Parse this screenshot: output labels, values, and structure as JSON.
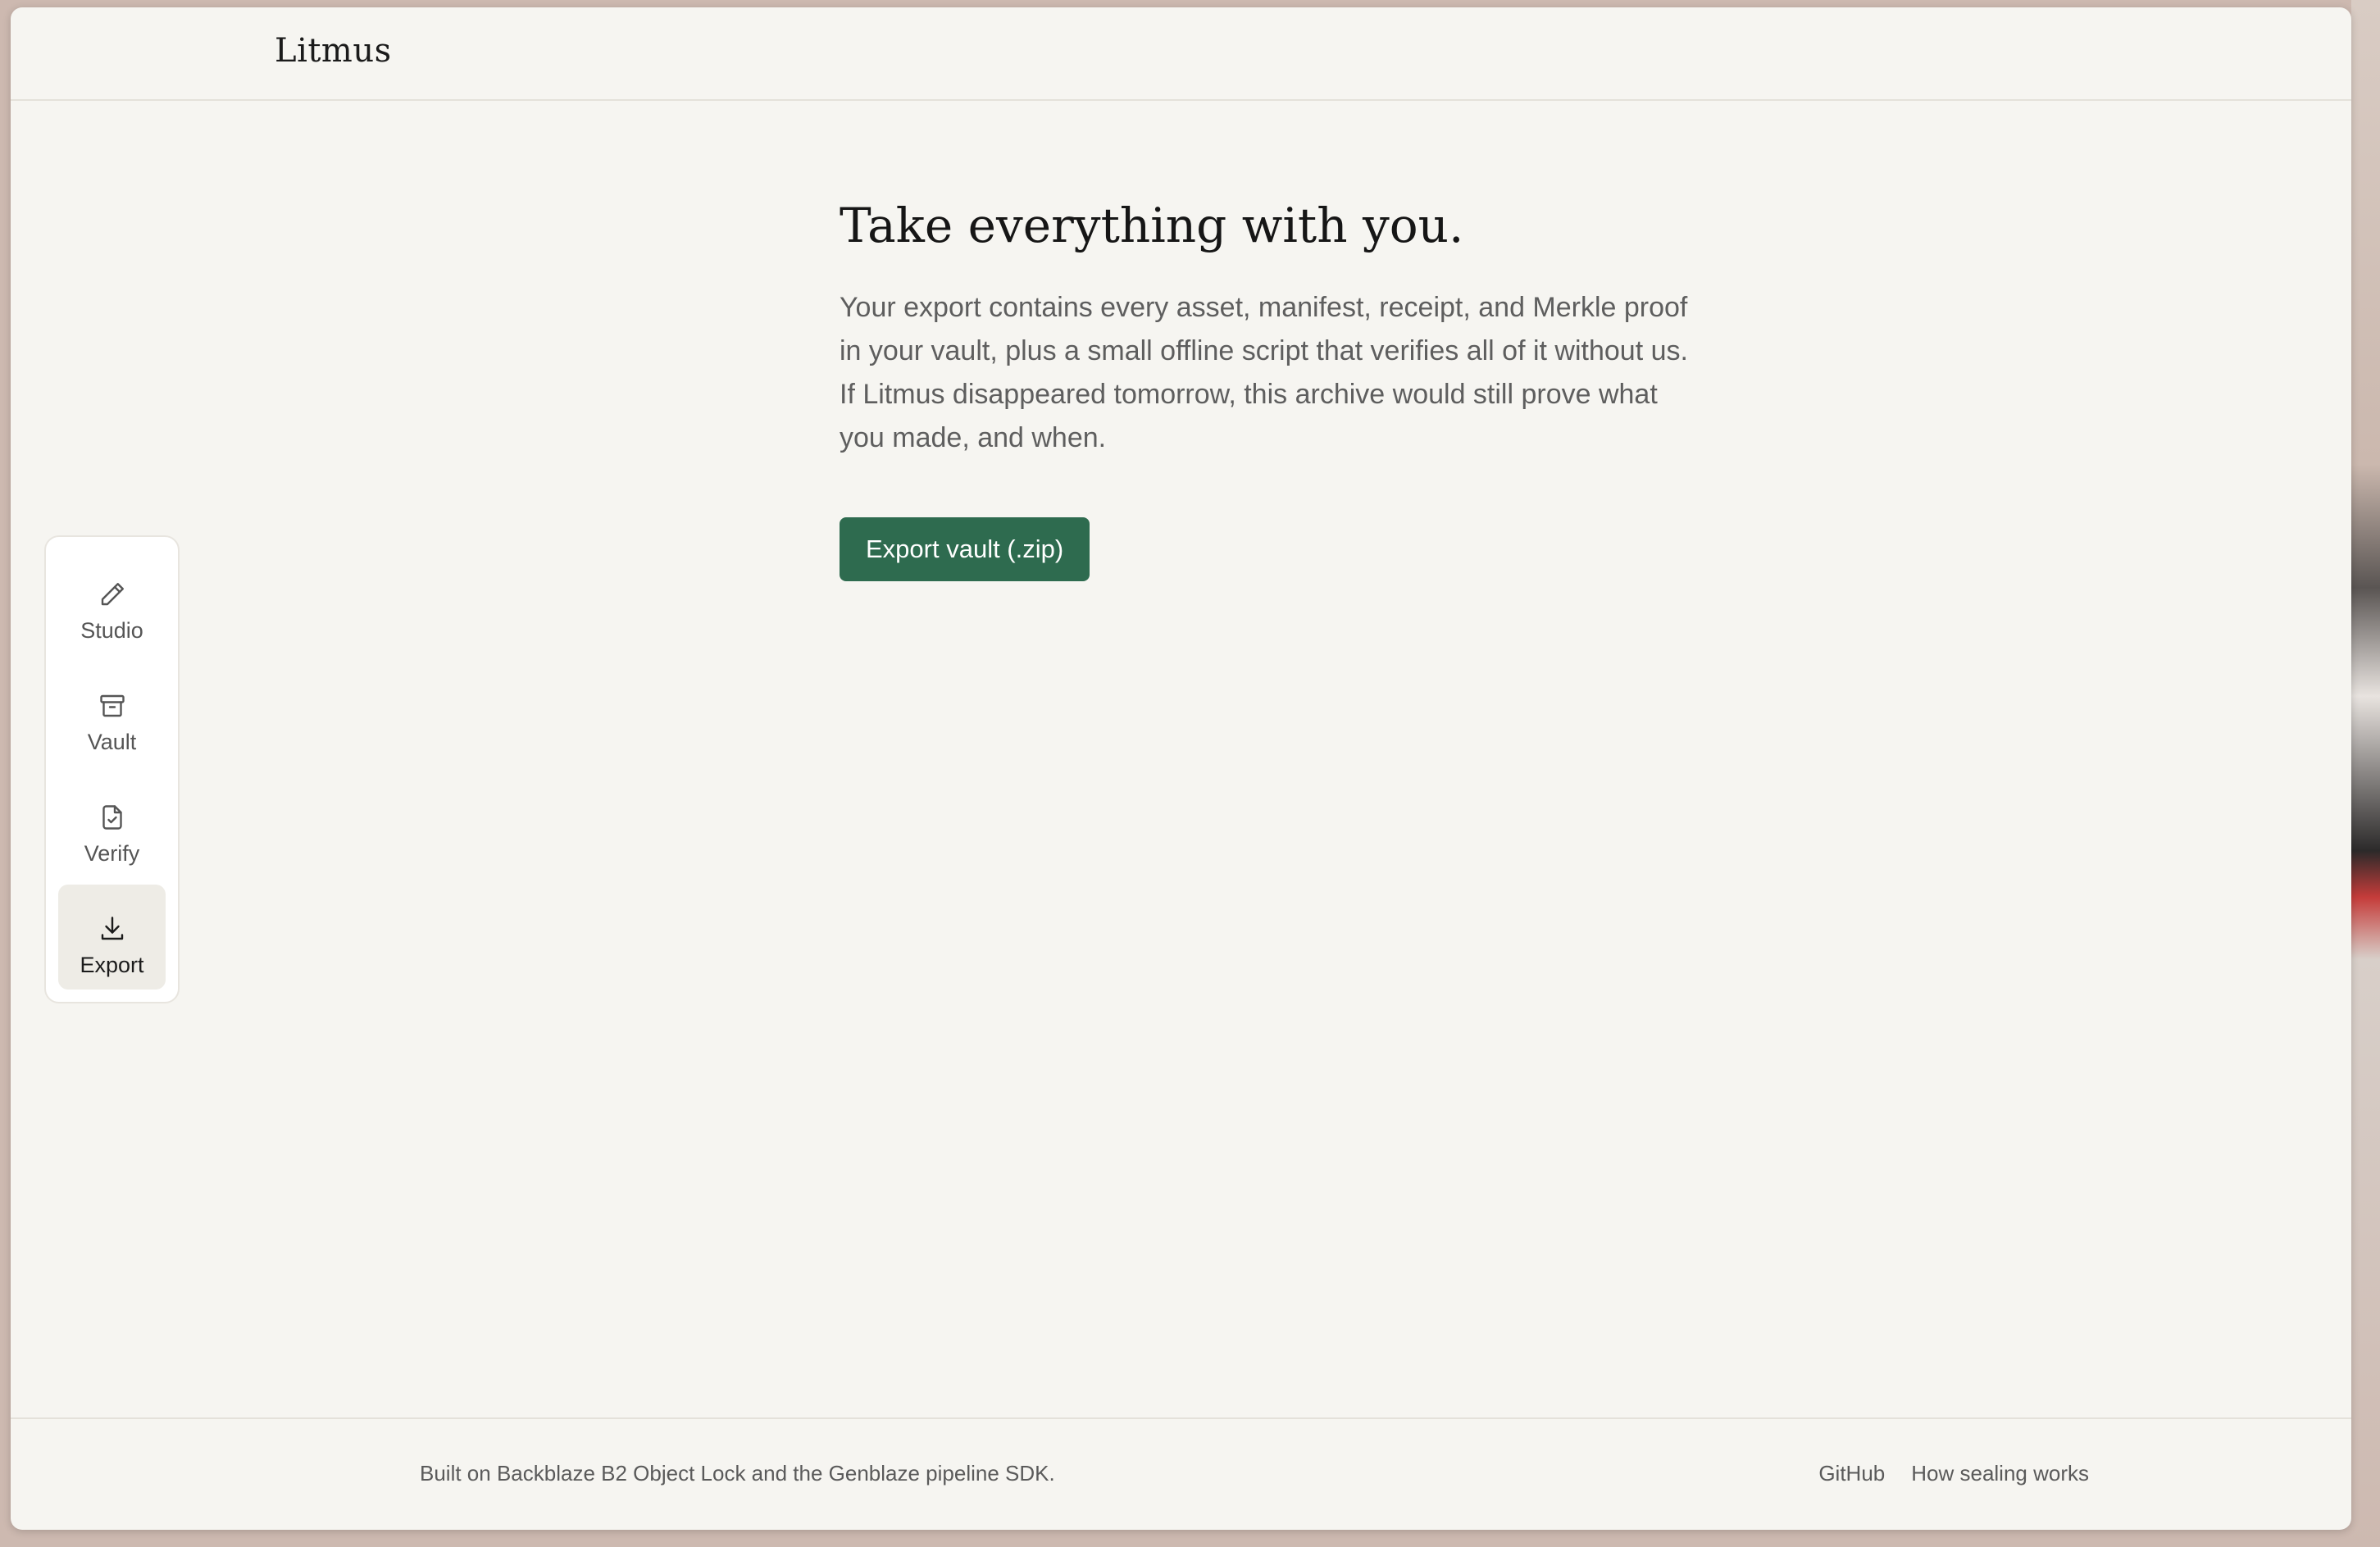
{
  "app": {
    "brand": "Litmus"
  },
  "nav": {
    "items": [
      {
        "label": "Studio",
        "icon": "pencil-icon",
        "active": false
      },
      {
        "label": "Vault",
        "icon": "archive-box-icon",
        "active": false
      },
      {
        "label": "Verify",
        "icon": "file-check-icon",
        "active": false
      },
      {
        "label": "Export",
        "icon": "download-icon",
        "active": true
      }
    ]
  },
  "main": {
    "title": "Take everything with you.",
    "description": "Your export contains every asset, manifest, receipt, and Merkle proof in your vault, plus a small offline script that verifies all of it without us. If Litmus disappeared tomorrow, this archive would still prove what you made, and when.",
    "export_button": "Export vault (.zip)"
  },
  "footer": {
    "note": "Built on Backblaze B2 Object Lock and the Genblaze pipeline SDK.",
    "links": [
      "GitHub",
      "How sealing works"
    ]
  },
  "colors": {
    "accent": "#2e6b4f",
    "background": "#f6f5f1",
    "rail_active": "#eeece6"
  }
}
